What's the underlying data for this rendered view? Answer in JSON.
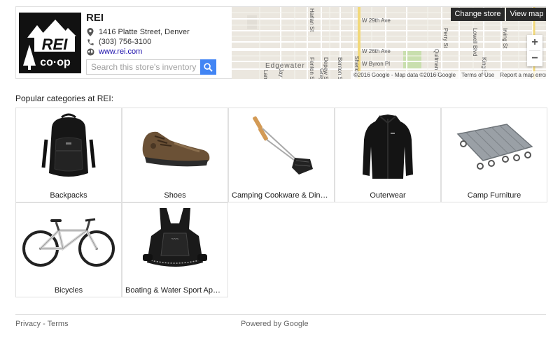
{
  "store": {
    "name": "REI",
    "address": "1416 Platte Street, Denver",
    "phone": "(303) 756-3100",
    "website": "www.rei.com",
    "logo_text": "REI co-op"
  },
  "search": {
    "placeholder": "Search this store's inventory",
    "value": ""
  },
  "map": {
    "change_store_label": "Change store",
    "view_map_label": "View map",
    "zoom_in": "+",
    "zoom_out": "−",
    "street_labels": [
      "W 29th Ave",
      "W 26th Ave",
      "W Byron Pl",
      "Edgewater",
      "Sheridan Blvd",
      "Perry St",
      "Lowell Blvd",
      "Irving St",
      "Quitman St",
      "King St",
      "Fenton St",
      "Depew St",
      "Benton St",
      "Harlan St",
      "Jay St",
      "Gray St",
      "Lamar St"
    ],
    "footer": {
      "copyright": "©2016 Google - Map data ©2016 Google",
      "terms": "Terms of Use",
      "report": "Report a map error"
    }
  },
  "popular_heading": "Popular categories at REI:",
  "categories": [
    {
      "label": "Backpacks",
      "icon": "backpack-icon"
    },
    {
      "label": "Shoes",
      "icon": "shoe-icon"
    },
    {
      "label": "Camping Cookware & Dinner…",
      "icon": "cookware-icon"
    },
    {
      "label": "Outerwear",
      "icon": "jacket-icon"
    },
    {
      "label": "Camp Furniture",
      "icon": "cot-icon"
    },
    {
      "label": "Bicycles",
      "icon": "bicycle-icon"
    },
    {
      "label": "Boating & Water Sport Apparel",
      "icon": "life-vest-icon"
    }
  ],
  "footer": {
    "privacy": "Privacy",
    "separator": " - ",
    "terms": "Terms",
    "powered_by": "Powered by Google"
  },
  "colors": {
    "accent": "#4285f4",
    "map_button": "#2a2a2a",
    "link": "#1a0dab"
  }
}
